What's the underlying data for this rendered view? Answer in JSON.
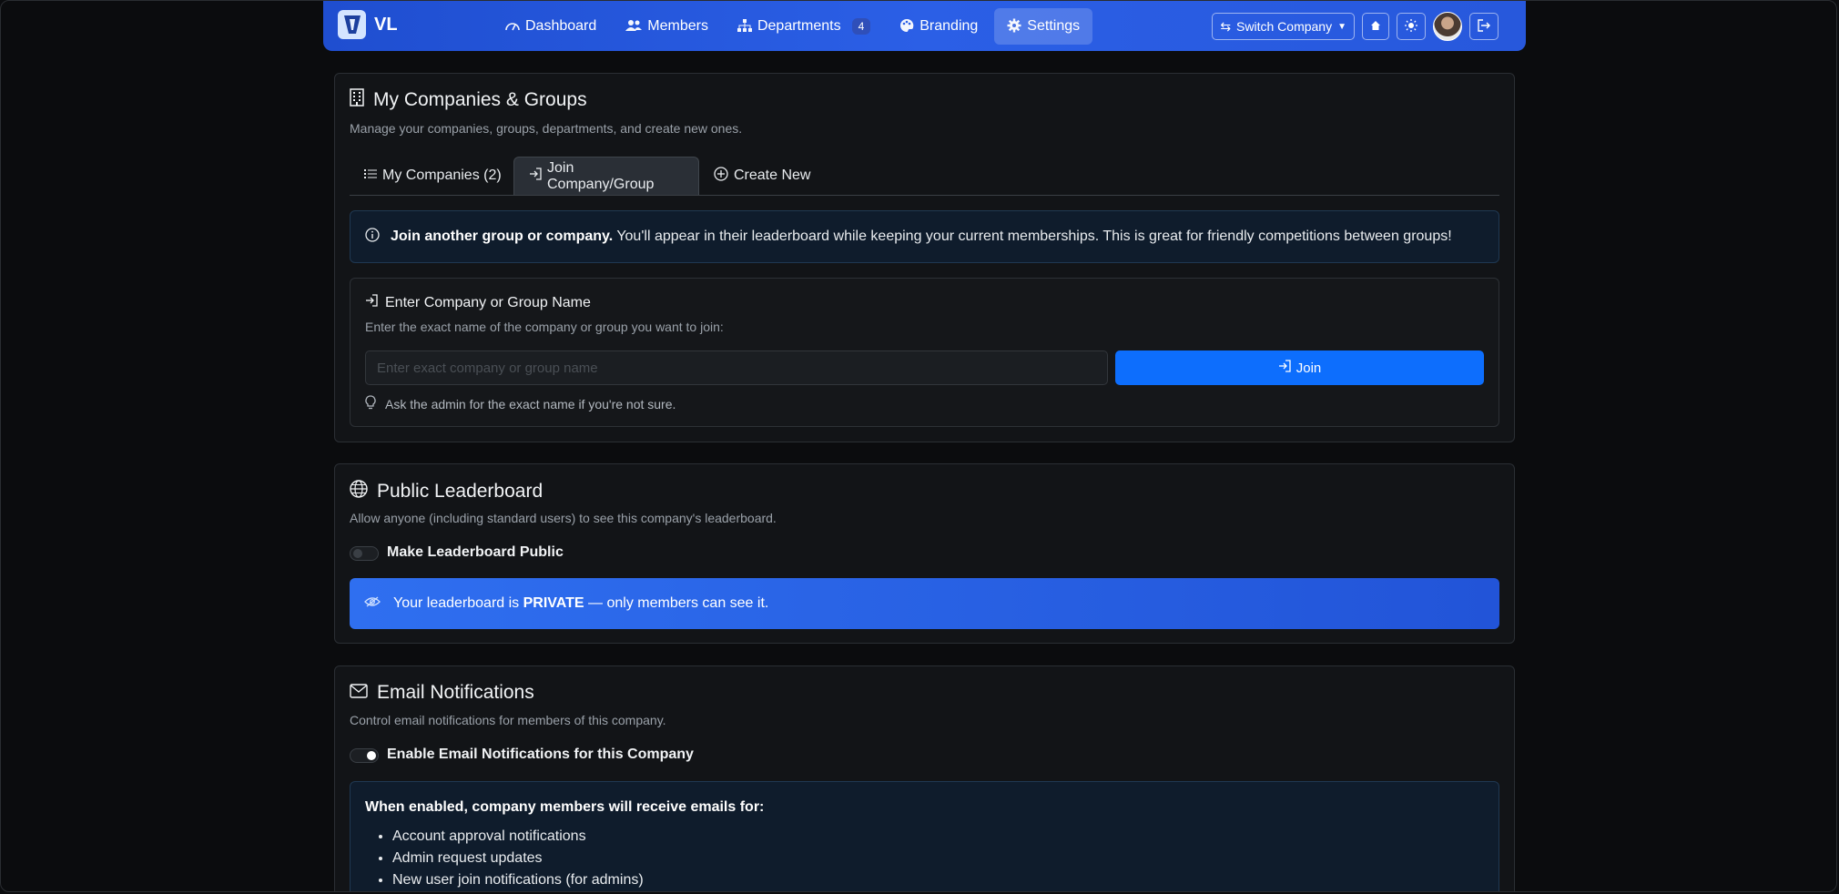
{
  "nav": {
    "brand": "VL",
    "links": [
      {
        "label": "Dashboard",
        "icon": "dashboard-icon"
      },
      {
        "label": "Members",
        "icon": "people-icon"
      },
      {
        "label": "Departments",
        "icon": "diagram-icon",
        "badge": "4"
      },
      {
        "label": "Branding",
        "icon": "palette-icon"
      },
      {
        "label": "Settings",
        "icon": "gear-icon",
        "active": true
      }
    ],
    "switch_company": "Switch Company"
  },
  "companies": {
    "title": "My Companies & Groups",
    "subtitle": "Manage your companies, groups, departments, and create new ones.",
    "tabs": {
      "my_companies": "My Companies (2)",
      "join": "Join Company/Group",
      "create": "Create New"
    },
    "info_bold": "Join another group or company.",
    "info_text": "You'll appear in their leaderboard while keeping your current memberships. This is great for friendly competitions between groups!",
    "join": {
      "title": "Enter Company or Group Name",
      "desc": "Enter the exact name of the company or group you want to join:",
      "placeholder": "Enter exact company or group name",
      "button": "Join",
      "hint": "Ask the admin for the exact name if you're not sure."
    }
  },
  "leaderboard": {
    "title": "Public Leaderboard",
    "subtitle": "Allow anyone (including standard users) to see this company's leaderboard.",
    "toggle_label": "Make Leaderboard Public",
    "toggle_on": false,
    "banner_pre": "Your leaderboard is",
    "banner_bold": "PRIVATE",
    "banner_post": "— only members can see it."
  },
  "email": {
    "title": "Email Notifications",
    "subtitle": "Control email notifications for members of this company.",
    "toggle_label": "Enable Email Notifications for this Company",
    "toggle_on": false,
    "box_head": "When enabled, company members will receive emails for:",
    "items": [
      "Account approval notifications",
      "Admin request updates",
      "New user join notifications (for admins)"
    ]
  },
  "colors": {
    "primary": "#0d6efd",
    "navbar": "#2b5fe6",
    "background": "#0b0c0e"
  }
}
